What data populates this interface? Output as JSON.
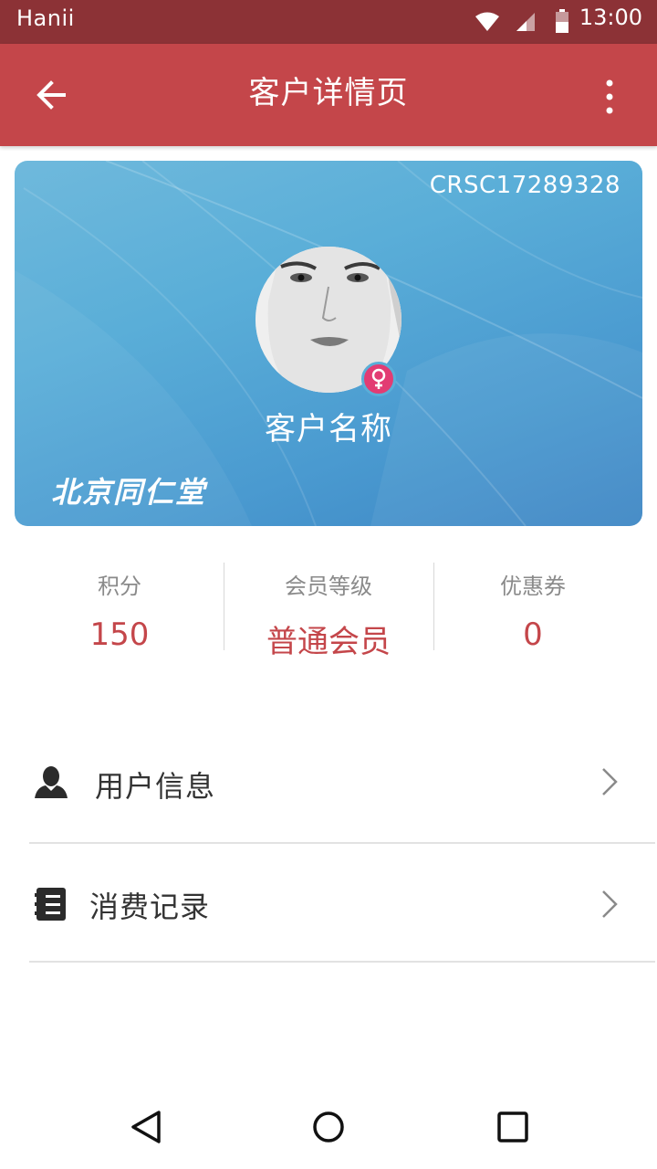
{
  "status_bar": {
    "carrier": "Hanii",
    "time": "13:00"
  },
  "app_bar": {
    "title": "客户详情页"
  },
  "card": {
    "member_no": "CRSC17289328",
    "customer_name": "客户名称",
    "brand": "北京同仁堂",
    "gender": "female"
  },
  "stats": [
    {
      "label": "积分",
      "value": "150"
    },
    {
      "label": "会员等级",
      "value": "普通会员"
    },
    {
      "label": "优惠券",
      "value": "0"
    }
  ],
  "menu": [
    {
      "label": "用户信息",
      "icon": "user-icon"
    },
    {
      "label": "消费记录",
      "icon": "receipt-icon"
    }
  ],
  "colors": {
    "accent": "#c4464a",
    "status_bar": "#8c3236",
    "card_blue": "#5aaed8",
    "female_badge": "#e23c73"
  }
}
